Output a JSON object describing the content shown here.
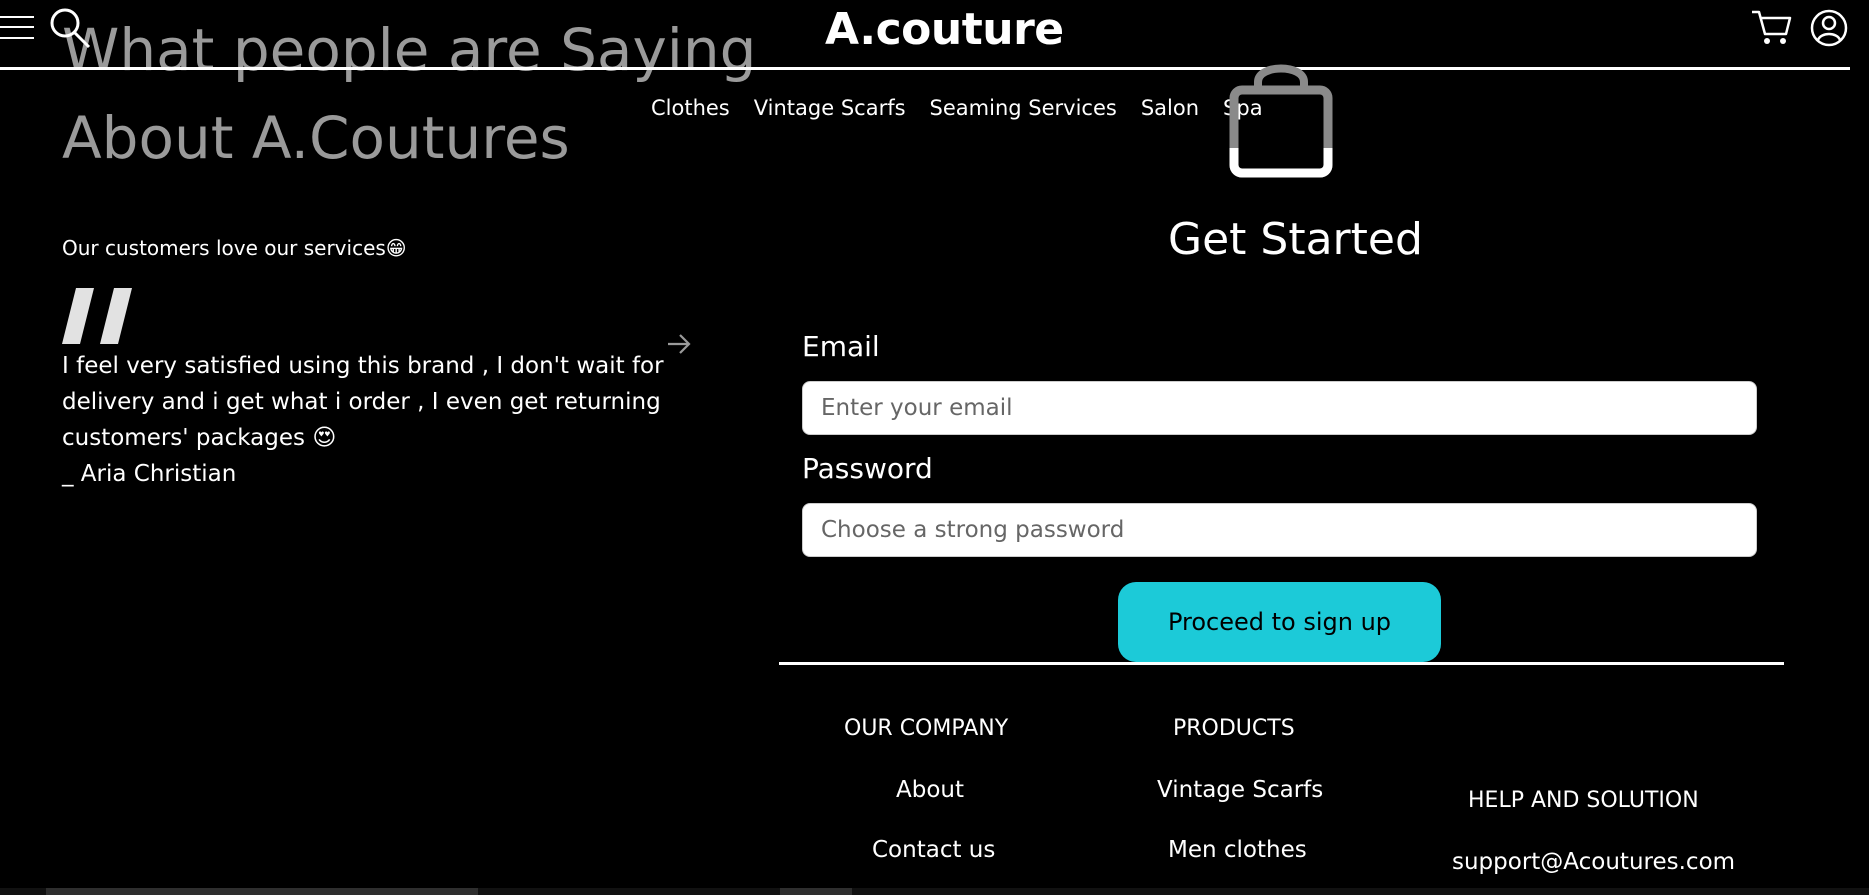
{
  "header": {
    "brand": "A.couture",
    "hero_title": "What people are Saying\nAbout A.Coutures",
    "nav": [
      "Clothes",
      "Vintage Scarfs",
      "Seaming Services",
      "Salon",
      "Spa"
    ],
    "icons": [
      "hamburger-menu-icon",
      "search-icon",
      "cart-icon",
      "user-icon",
      "shopping-bag-icon"
    ]
  },
  "testimonial": {
    "tagline": "Our customers love our services😁",
    "quote": "I feel very satisfied using this brand , I don't wait for delivery and i get what i order , I even get returning customers' packages 😍",
    "author": "_ Aria Christian"
  },
  "signup": {
    "title": "Get Started",
    "email_label": "Email",
    "email_placeholder": "Enter your email",
    "password_label": "Password",
    "password_placeholder": "Choose a strong password",
    "submit_label": "Proceed to sign up"
  },
  "footer": {
    "company": {
      "heading": "OUR COMPANY",
      "links": [
        "About",
        "Contact us"
      ]
    },
    "products": {
      "heading": "PRODUCTS",
      "links": [
        "Vintage Scarfs",
        "Men clothes"
      ]
    },
    "help": {
      "heading": "HELP AND SOLUTION",
      "email": "support@Acoutures.com"
    }
  },
  "colors": {
    "background": "#000000",
    "accent": "#1ccad8",
    "muted_text": "#9a9a9a"
  }
}
